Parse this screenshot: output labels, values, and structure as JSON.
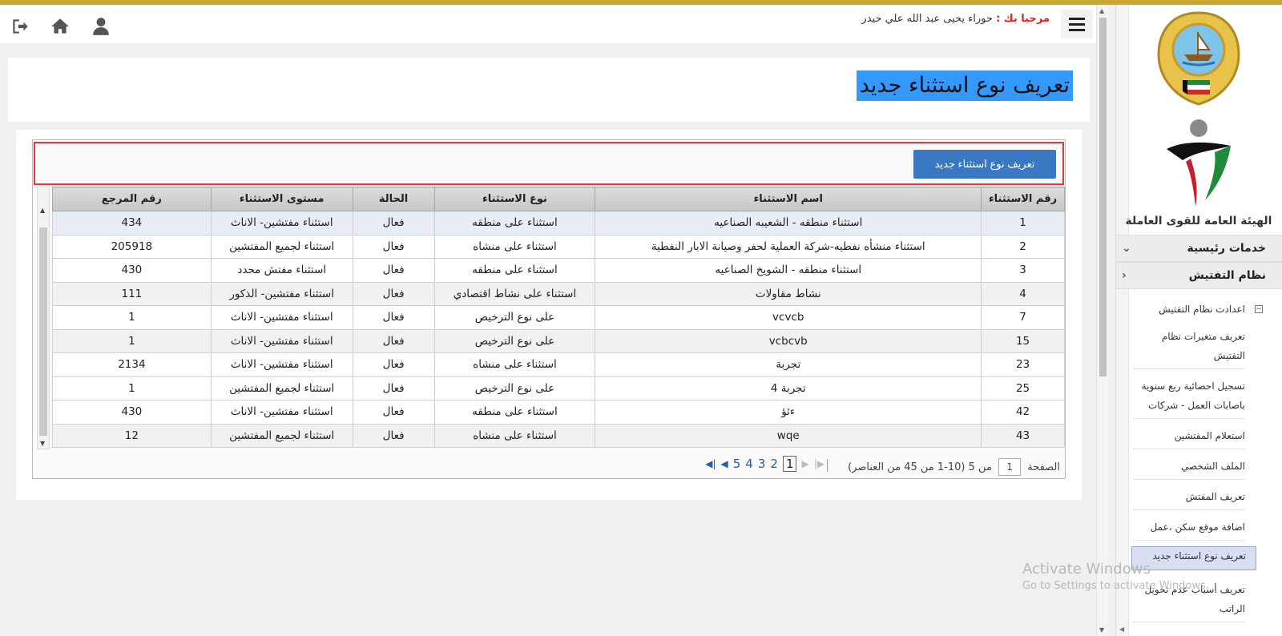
{
  "header": {
    "welcome_label": "مرحبا بك :",
    "user_name": "حوراء يحيى عبد الله علي حيدر"
  },
  "page": {
    "title": "تعريف نوع استثناء جديد",
    "new_button_label": "تعريف نوع استثناء جديد"
  },
  "sidebar": {
    "org_name": "الهيئة العامة للقوى العاملة",
    "main_services": "خدمات رئيسية",
    "inspection_system": "نظام التفتيش",
    "inspection_settings": "اعدادت نظام التفتيش",
    "items": [
      {
        "label": "تعريف متغيرات نظام التفتيش"
      },
      {
        "label": "تسجيل احصائية ربع سنوية باصابات العمل - شركات"
      },
      {
        "label": "استعلام المفتشين"
      },
      {
        "label": "الملف الشخصي"
      },
      {
        "label": "تعريف المفتش"
      },
      {
        "label": "اضافة موقع سكن ،عمل"
      },
      {
        "label": "تعريف نوع استثناء جديد"
      },
      {
        "label": "تعريف أسباب عدم تحويل الراتب"
      }
    ]
  },
  "table": {
    "columns": [
      "رقم الاستثناء",
      "اسم الاستثناء",
      "نوع الاستثناء",
      "الحالة",
      "مستوى الاستثناء",
      "رقم المرجع"
    ],
    "rows": [
      [
        "1",
        "استثناء منطقه - الشعيبه الصناعيه",
        "استثناء على منطقه",
        "فعال",
        "استثناء مفتشين- الاناث",
        "434"
      ],
      [
        "2",
        "استثناء منشأه نفطيه-شركة العملية لحفر وصيانة الابار النفطية",
        "استثناء على منشاه",
        "فعال",
        "استثناء لجميع المفتشين",
        "205918"
      ],
      [
        "3",
        "استثناء منطقه - الشويخ الصناعيه",
        "استثناء على منطقه",
        "فعال",
        "استثناء مفتش محدد",
        "430"
      ],
      [
        "4",
        "نشاط مقاولات",
        "استثناء على نشاط اقتصادي",
        "فعال",
        "استثناء مفتشين- الذكور",
        "111"
      ],
      [
        "7",
        "vcvcb",
        "على نوع الترخيص",
        "فعال",
        "استثناء مفتشين- الاناث",
        "1"
      ],
      [
        "15",
        "vcbcvb",
        "على نوع الترخيص",
        "فعال",
        "استثناء مفتشين- الاناث",
        "1"
      ],
      [
        "23",
        "تجربة",
        "استثناء على منشاه",
        "فعال",
        "استثناء مفتشين- الاناث",
        "2134"
      ],
      [
        "25",
        "تجربة 4",
        "على نوع الترخيص",
        "فعال",
        "استثناء لجميع المفتشين",
        "1"
      ],
      [
        "42",
        "ءئؤ",
        "استثناء على منطقه",
        "فعال",
        "استثناء مفتشين- الاناث",
        "430"
      ],
      [
        "43",
        "wqe",
        "استثناء على منشاه",
        "فعال",
        "استثناء لجميع المفتشين",
        "12"
      ]
    ]
  },
  "pager": {
    "page_label": "الصفحة",
    "current_page": "1",
    "of_text": "من 5 (10-1 من 45 من العناصر)",
    "pages": [
      "1",
      "2",
      "3",
      "4",
      "5"
    ]
  },
  "watermark": {
    "line1": "Activate Windows",
    "line2": "Go to Settings to activate Windows."
  },
  "colors": {
    "top_stripe": "#c8a82e",
    "accent_button": "#3a78c2",
    "title_highlight": "#3399ff",
    "welcome_label": "#e02020",
    "focus_outline": "#e5383b"
  }
}
